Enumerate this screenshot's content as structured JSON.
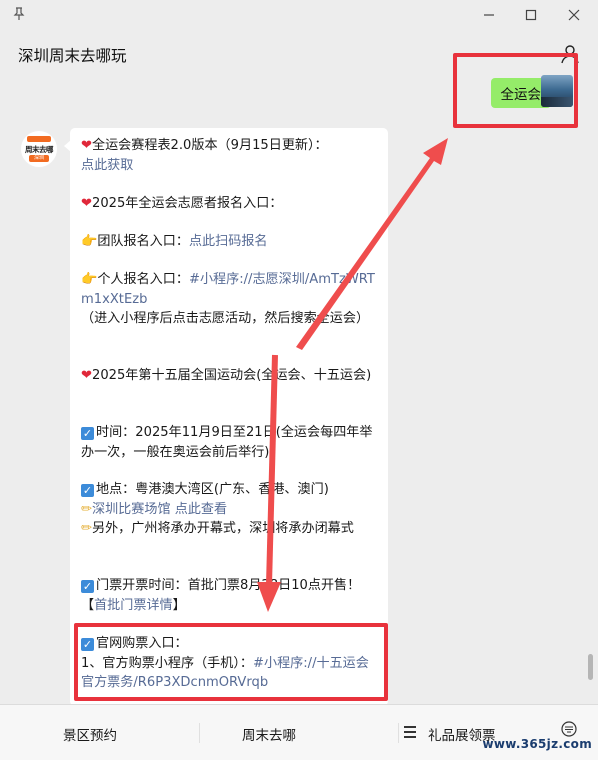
{
  "window": {
    "pin_icon": "pin-icon",
    "min_icon": "minimize-icon",
    "max_icon": "maximize-icon",
    "close_icon": "close-icon"
  },
  "chat": {
    "title": "深圳周末去哪玩",
    "my_message": "全运会",
    "bot_avatar_top": "周末去哪",
    "bot_avatar_bottom": "深圳"
  },
  "messages": {
    "p1_a": "全运会赛程表2.0版本（9月15日更新）：",
    "p1_link": "点此获取",
    "p2": "2025年全运会志愿者报名入口：",
    "p3_a": "团队报名入口：",
    "p3_link": "点此扫码报名",
    "p4_a": "个人报名入口：",
    "p4_link": "#小程序://志愿深圳/AmTzWRTm1xXtEzb",
    "p4_b": "（进入小程序后点击志愿活动，然后搜索全运会）",
    "p5": "2025年第十五届全国运动会(全运会、十五运会)",
    "p6": "时间：2025年11月9日至21日(全运会每四年举办一次，一般在奥运会前后举行)",
    "p7_a": "地点：粤港澳大湾区(广东、香港、澳门)",
    "p7_link": "深圳比赛场馆 点此查看",
    "p7_b": "另外，广州将承办开幕式，深圳将承办闭幕式",
    "p8_a": "门票开票时间：首批门票8月28日10点开售！【",
    "p8_link": "首批门票详情",
    "p8_b": "】",
    "p9_a": "官网购票入口：",
    "p9_b": "1、官方购票小程序（手机）：",
    "p9_link": "#小程序://十五运会官方票务/R6P3XDcnmORVrqb"
  },
  "menu": {
    "item1": "景区预约",
    "item2": "周末去哪",
    "item3": "礼品展领票",
    "watermark": "www.365jz.com"
  },
  "colors": {
    "bubble_green": "#95ec69",
    "link": "#576b95",
    "highlight": "#e8323c"
  }
}
